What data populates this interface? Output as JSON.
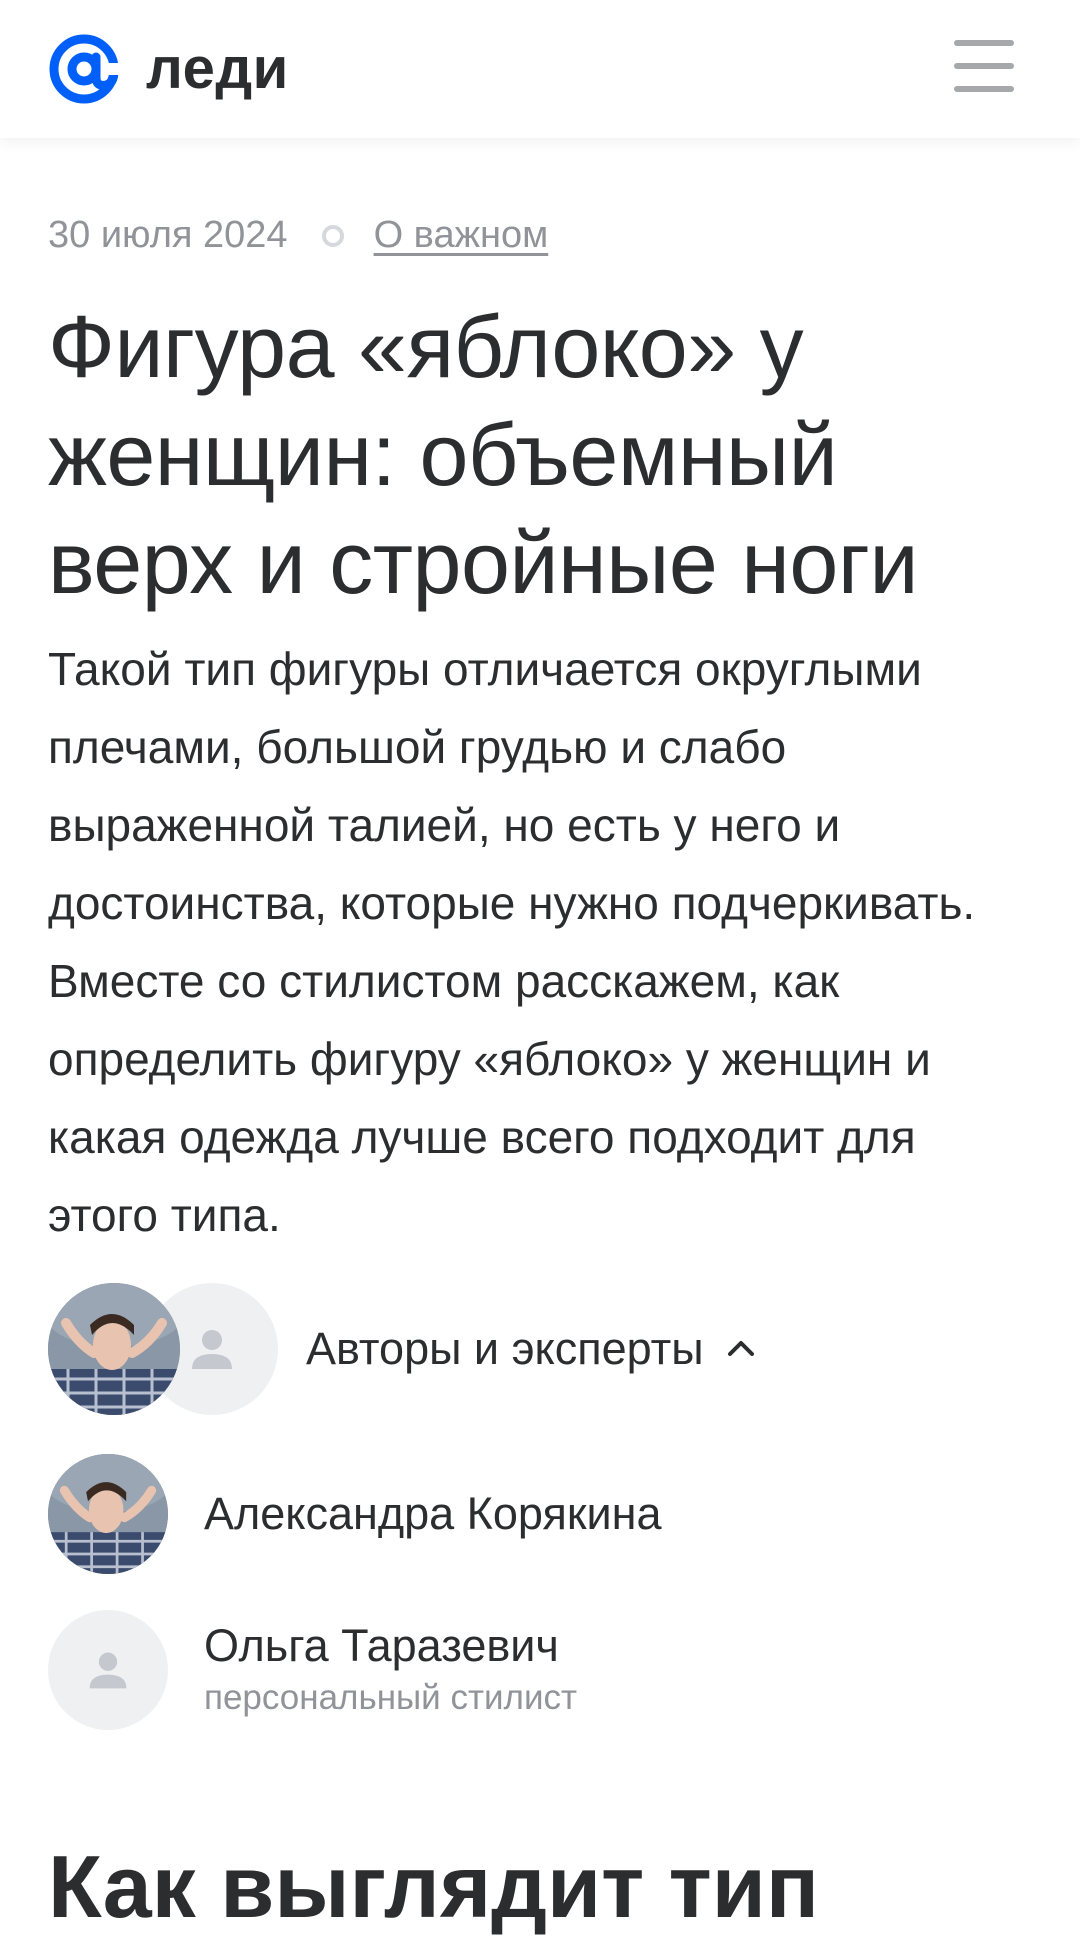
{
  "header": {
    "logo_text": "леди",
    "logo_icon": "at-sign-icon",
    "menu_icon": "hamburger-menu-icon",
    "accent_color": "#005ff9"
  },
  "article": {
    "date": "30 июля 2024",
    "category": "О важном",
    "title": "Фигура «яблоко» у женщин: объемный верх и стройные ноги",
    "lead": "Такой тип фигуры отличается округлыми плечами, большой грудью и слабо выраженной талией, но есть у него и достоинства, которые нужно подчеркивать. Вместе со стилистом расскажем, как определить фигуру «яблоко» у женщин и какая одежда лучше всего подходит для этого типа."
  },
  "authors": {
    "label": "Авторы и эксперты",
    "toggle_icon": "chevron-up-icon",
    "list": [
      {
        "name": "Александра Корякина",
        "role": "",
        "avatar": "photo"
      },
      {
        "name": "Ольга Таразевич",
        "role": "персональный стилист",
        "avatar": "placeholder-user-icon"
      }
    ]
  },
  "section": {
    "heading": "Как выглядит тип"
  }
}
